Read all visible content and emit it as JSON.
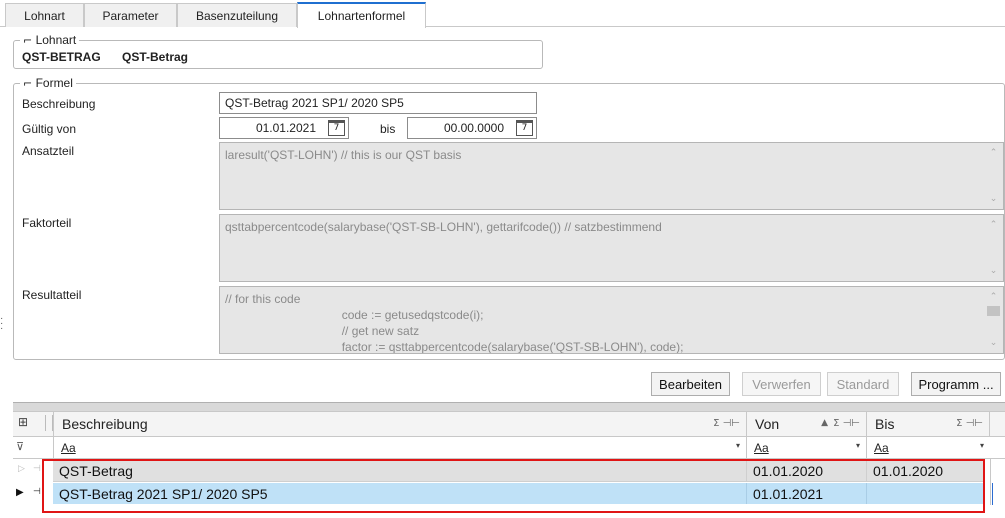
{
  "tabs": [
    {
      "label": "Lohnart",
      "active": false
    },
    {
      "label": "Parameter",
      "active": false
    },
    {
      "label": "Basenzuteilung",
      "active": false
    },
    {
      "label": "Lohnartenformel",
      "active": true
    }
  ],
  "lohnart": {
    "legend": "Lohnart",
    "code": "QST-BETRAG",
    "name": "QST-Betrag"
  },
  "formel": {
    "legend": "Formel",
    "beschreibung_label": "Beschreibung",
    "beschreibung_value": "QST-Betrag 2021 SP1/ 2020 SP5",
    "gueltig_label": "Gültig von",
    "von_value": "01.01.2021",
    "bis_label": "bis",
    "bis_value": "00.00.0000",
    "ansatz_label": "Ansatzteil",
    "ansatz_text": "laresult('QST-LOHN') // this is our QST basis",
    "faktor_label": "Faktorteil",
    "faktor_text": "qsttabpercentcode(salarybase('QST-SB-LOHN'), gettarifcode()) // satzbestimmend",
    "result_label": "Resultatteil",
    "result_text": "// for this code\n                                   code := getusedqstcode(i);\n                                   // get new satz\n                                   factor := qsttabpercentcode(salarybase('QST-SB-LOHN'), code);"
  },
  "buttons": {
    "bearbeiten": "Bearbeiten",
    "verwerfen": "Verwerfen",
    "standard": "Standard",
    "programm": "Programm ..."
  },
  "grid": {
    "columns": {
      "beschreibung": "Beschreibung",
      "von": "Von",
      "bis": "Bis"
    },
    "sum_pin": "Σ ⊣⊢",
    "filter_placeholder": "Aa",
    "rows": [
      {
        "beschreibung": "QST-Betrag",
        "von": "01.01.2020",
        "bis": "01.01.2020",
        "selected": false
      },
      {
        "beschreibung": "QST-Betrag 2021 SP1/ 2020 SP5",
        "von": "01.01.2021",
        "bis": "",
        "selected": true
      }
    ],
    "sort_indicator": "▲",
    "current_row_marker": "▶"
  }
}
